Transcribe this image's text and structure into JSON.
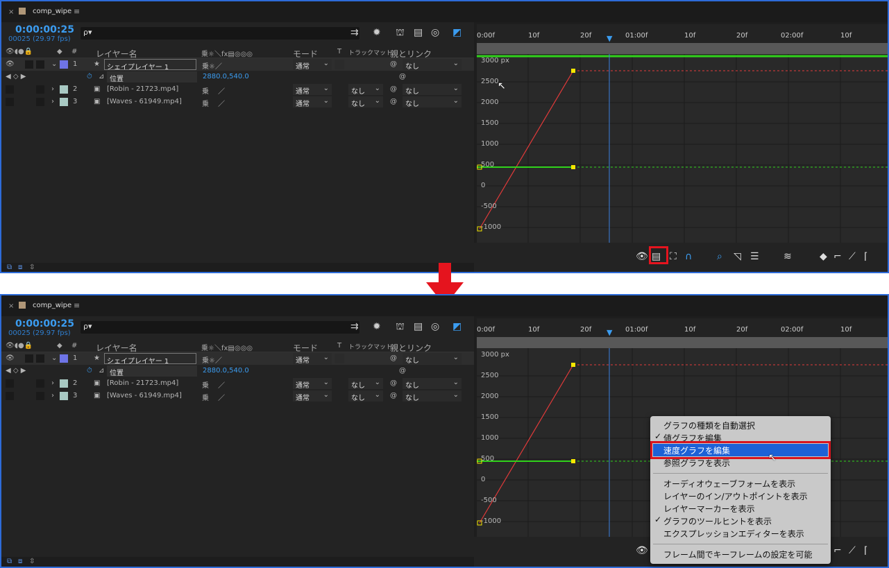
{
  "tab": {
    "close": "×",
    "title": "comp_wipe",
    "menu": "≡"
  },
  "timecode": "0:00:00:25",
  "fps": "00025 (29.97 fps)",
  "search": {
    "icon": "search-icon",
    "glyph": "ρ▾"
  },
  "columns": {
    "hash": "#",
    "layer_name": "レイヤー名",
    "switches": "乗☼＼fx▤◎◎◎",
    "mode": "モード",
    "t": "T",
    "trackmatte": "トラックマット",
    "parent": "親とリンク"
  },
  "layers": [
    {
      "num": "1",
      "name": "シェイプレイヤー 1",
      "mode": "通常",
      "parent": "なし",
      "color": "#6e74e6"
    },
    {
      "num": "2",
      "name": "[Robin - 21723.mp4]",
      "mode": "通常",
      "matte": "なし",
      "parent": "なし",
      "color": "#a8c9c3"
    },
    {
      "num": "3",
      "name": "[Waves - 61949.mp4]",
      "mode": "通常",
      "matte": "なし",
      "parent": "なし",
      "color": "#a8c9c3"
    }
  ],
  "property": {
    "name": "位置",
    "value": "2880.0,540.0"
  },
  "ruler_ticks": [
    "0:00f",
    "10f",
    "20f",
    "01:00f",
    "10f",
    "20f",
    "02:00f",
    "10f"
  ],
  "y_labels": [
    "3000 px",
    "2500",
    "2000",
    "1500",
    "1000",
    "500",
    "0",
    "-500",
    "-1000"
  ],
  "context_menu": {
    "items": [
      {
        "label": "グラフの種類を自動選択",
        "checked": false
      },
      {
        "label": "値グラフを編集",
        "checked": true
      },
      {
        "label": "速度グラフを編集",
        "checked": false,
        "highlighted": true
      },
      {
        "label": "参照グラフを表示",
        "checked": false
      },
      {
        "label": "オーディオウェーブフォームを表示",
        "checked": false
      },
      {
        "label": "レイヤーのイン/アウトポイントを表示",
        "checked": false
      },
      {
        "label": "レイヤーマーカーを表示",
        "checked": false
      },
      {
        "label": "グラフのツールヒントを表示",
        "checked": true
      },
      {
        "label": "エクスプレッションエディターを表示",
        "checked": false
      },
      {
        "label": "フレーム間でキーフレームの設定を可能",
        "checked": false
      }
    ],
    "check_glyph": "✓"
  },
  "colors": {
    "accent": "#3b9cf0",
    "highlight": "#1d61d6",
    "red": "#e5141e",
    "graph_red": "#e23a3a",
    "graph_green": "#2fd21a",
    "keyframe": "#f5e600"
  }
}
